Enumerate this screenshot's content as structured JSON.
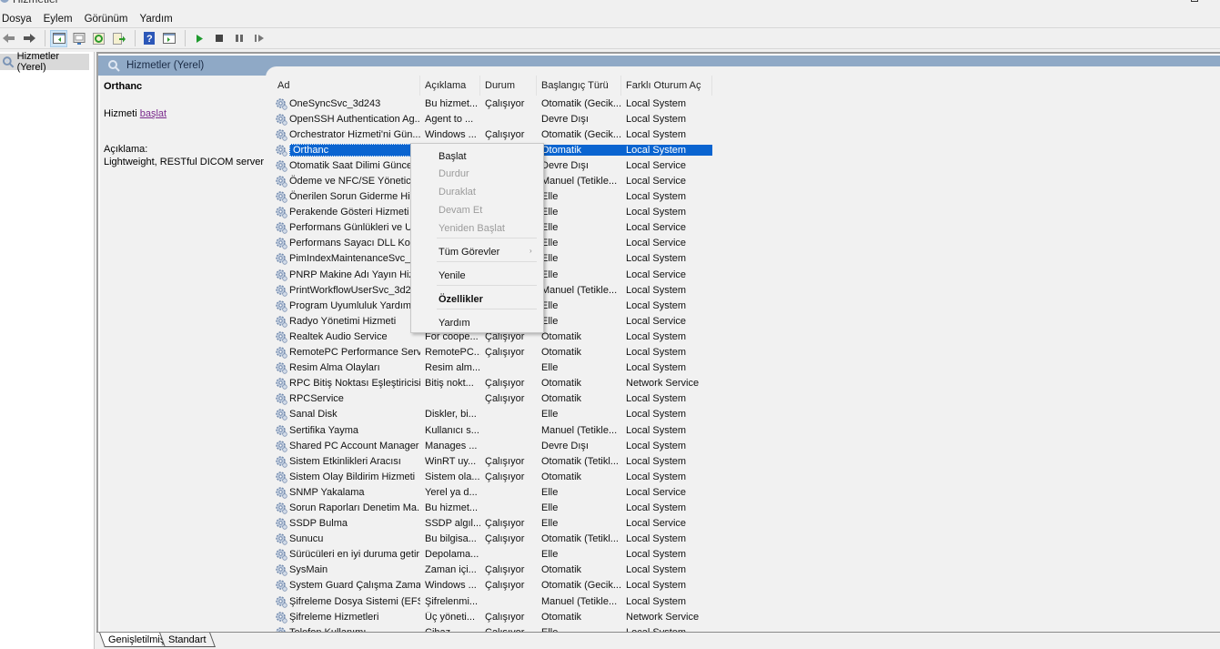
{
  "window": {
    "title": "Hizmetler"
  },
  "menu": [
    "Dosya",
    "Eylem",
    "Görünüm",
    "Yardım"
  ],
  "toolbar": {
    "icons": [
      "back-icon",
      "forward-icon",
      "show-hide-console-tree-icon",
      "properties-icon",
      "refresh-icon",
      "export-list-icon",
      "help-icon",
      "show-action-pane-icon",
      "start-service-icon",
      "stop-service-icon",
      "pause-service-icon",
      "resume-service-icon"
    ]
  },
  "tree": {
    "root_label": "Hizmetler (Yerel)"
  },
  "header": {
    "title": "Hizmetler (Yerel)"
  },
  "description_pane": {
    "service_name": "Orthanc",
    "action_prefix": "Hizmeti ",
    "action_link": "başlat",
    "description_label": "Açıklama:",
    "description_text": "Lightweight, RESTful DICOM server"
  },
  "table": {
    "columns": [
      "Ad",
      "Açıklama",
      "Durum",
      "Başlangıç Türü",
      "Farklı Oturum Aç"
    ],
    "selected_index": 3,
    "rows": [
      [
        "OneSyncSvc_3d243",
        "Bu hizmet...",
        "Çalışıyor",
        "Otomatik (Gecik...",
        "Local System"
      ],
      [
        "OpenSSH Authentication Ag...",
        "Agent to ...",
        "",
        "Devre Dışı",
        "Local System"
      ],
      [
        "Orchestrator Hizmeti'ni Gün...",
        "Windows ...",
        "Çalışıyor",
        "Otomatik (Gecik...",
        "Local System"
      ],
      [
        "Orthanc",
        "",
        "",
        "Otomatik",
        "Local System"
      ],
      [
        "Otomatik Saat Dilimi Güncel",
        "",
        "",
        "Devre Dışı",
        "Local Service"
      ],
      [
        "Ödeme ve NFC/SE Yöneticisi",
        "",
        "",
        "Manuel (Tetikle...",
        "Local Service"
      ],
      [
        "Önerilen Sorun Giderme Hiz",
        "",
        "",
        "Elle",
        "Local System"
      ],
      [
        "Perakende Gösteri Hizmeti",
        "",
        "",
        "Elle",
        "Local System"
      ],
      [
        "Performans Günlükleri ve Uy",
        "",
        "",
        "Elle",
        "Local Service"
      ],
      [
        "Performans Sayacı DLL Kona",
        "",
        "",
        "Elle",
        "Local Service"
      ],
      [
        "PimIndexMaintenanceSvc_3.",
        "",
        "",
        "Elle",
        "Local System"
      ],
      [
        "PNRP Makine Adı Yayın Hiz...",
        "",
        "",
        "Elle",
        "Local Service"
      ],
      [
        "PrintWorkflowUserSvc_3d24.",
        "",
        "",
        "Manuel (Tetikle...",
        "Local System"
      ],
      [
        "Program Uyumluluk Yardımc",
        "",
        "",
        "Elle",
        "Local System"
      ],
      [
        "Radyo Yönetimi Hizmeti",
        "",
        "",
        "Elle",
        "Local Service"
      ],
      [
        "Realtek Audio Service",
        "For coope...",
        "Çalışıyor",
        "Otomatik",
        "Local System"
      ],
      [
        "RemotePC Performance Serv...",
        "RemotePC...",
        "Çalışıyor",
        "Otomatik",
        "Local System"
      ],
      [
        "Resim Alma Olayları",
        "Resim alm...",
        "",
        "Elle",
        "Local System"
      ],
      [
        "RPC Bitiş Noktası Eşleştiricisi",
        "Bitiş nokt...",
        "Çalışıyor",
        "Otomatik",
        "Network Service"
      ],
      [
        "RPCService",
        "",
        "Çalışıyor",
        "Otomatik",
        "Local System"
      ],
      [
        "Sanal Disk",
        "Diskler, bi...",
        "",
        "Elle",
        "Local System"
      ],
      [
        "Sertifika Yayma",
        "Kullanıcı s...",
        "",
        "Manuel (Tetikle...",
        "Local System"
      ],
      [
        "Shared PC Account Manager",
        "Manages ...",
        "",
        "Devre Dışı",
        "Local System"
      ],
      [
        "Sistem Etkinlikleri Aracısı",
        "WinRT uy...",
        "Çalışıyor",
        "Otomatik (Tetikl...",
        "Local System"
      ],
      [
        "Sistem Olay Bildirim Hizmeti",
        "Sistem ola...",
        "Çalışıyor",
        "Otomatik",
        "Local System"
      ],
      [
        "SNMP Yakalama",
        "Yerel ya d...",
        "",
        "Elle",
        "Local Service"
      ],
      [
        "Sorun Raporları Denetim Ma...",
        "Bu hizmet...",
        "",
        "Elle",
        "Local System"
      ],
      [
        "SSDP Bulma",
        "SSDP algıl...",
        "Çalışıyor",
        "Elle",
        "Local Service"
      ],
      [
        "Sunucu",
        "Bu bilgisa...",
        "Çalışıyor",
        "Otomatik (Tetikl...",
        "Local System"
      ],
      [
        "Sürücüleri en iyi duruma getir",
        "Depolama...",
        "",
        "Elle",
        "Local System"
      ],
      [
        "SysMain",
        "Zaman içi...",
        "Çalışıyor",
        "Otomatik",
        "Local System"
      ],
      [
        "System Guard Çalışma Zama...",
        "Windows ...",
        "Çalışıyor",
        "Otomatik (Gecik...",
        "Local System"
      ],
      [
        "Şifreleme Dosya Sistemi (EFS)",
        "Şifrelenmi...",
        "",
        "Manuel (Tetikle...",
        "Local System"
      ],
      [
        "Şifreleme Hizmetleri",
        "Üç yöneti...",
        "Çalışıyor",
        "Otomatik",
        "Network Service"
      ],
      [
        "Telefon Kullanımı",
        "Cihaz...",
        "Çalışıyor",
        "Elle",
        "Local System"
      ]
    ]
  },
  "context_menu": {
    "items": [
      {
        "label": "Başlat",
        "disabled": false,
        "bold": false
      },
      {
        "label": "Durdur",
        "disabled": true,
        "bold": false
      },
      {
        "label": "Duraklat",
        "disabled": true,
        "bold": false
      },
      {
        "label": "Devam Et",
        "disabled": true,
        "bold": false
      },
      {
        "label": "Yeniden Başlat",
        "disabled": true,
        "bold": false
      },
      {
        "label": "Tüm Görevler",
        "disabled": false,
        "bold": false,
        "submenu": true
      },
      {
        "label": "Yenile",
        "disabled": false,
        "bold": false
      },
      {
        "label": "Özellikler",
        "disabled": false,
        "bold": true
      },
      {
        "label": "Yardım",
        "disabled": false,
        "bold": false
      }
    ]
  },
  "bottom_tabs": [
    "Genişletilmiş",
    "Standart"
  ],
  "colors": {
    "selection": "#0a64d0",
    "header_band": "#8fa9c6",
    "link": "#7a2a8c"
  }
}
